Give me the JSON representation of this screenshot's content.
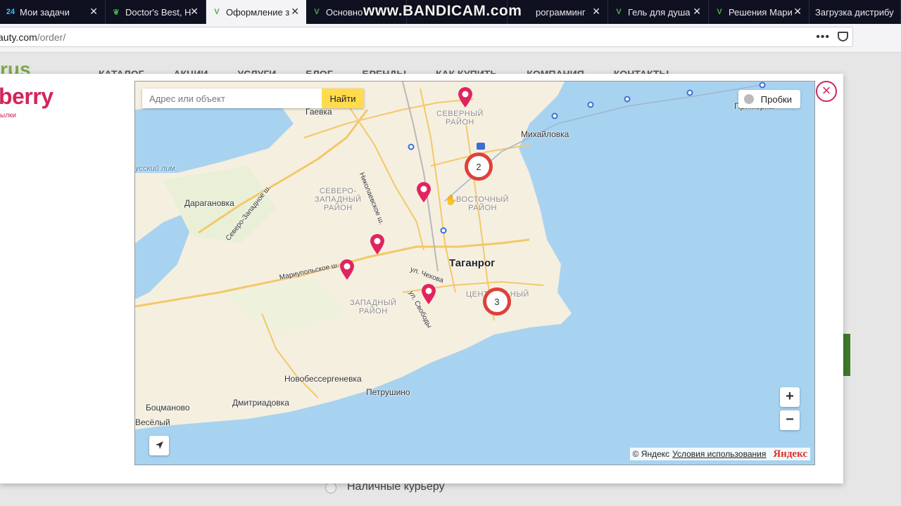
{
  "browser": {
    "tabs": [
      {
        "label": "Мои задачи",
        "icon": "bitrix24-icon",
        "icon_text": "24",
        "icon_color": "#2fc6f6",
        "active": false
      },
      {
        "label": "Doctor's Best, H",
        "icon": "leaf-icon",
        "icon_color": "#4caf50",
        "active": false
      },
      {
        "label": "Оформление з",
        "icon": "check-v-icon",
        "icon_color": "#4caf50",
        "active": true
      },
      {
        "label": "Основно",
        "icon": "check-v-icon",
        "icon_color": "#4caf50",
        "active": false
      },
      {
        "label": "рограмминг",
        "icon": "check-v-icon",
        "icon_color": "#4caf50",
        "active": false
      },
      {
        "label": "Гель для душа",
        "icon": "check-v-icon",
        "icon_color": "#4caf50",
        "active": false
      },
      {
        "label": "Решения Мари",
        "icon": "check-v-icon",
        "icon_color": "#4caf50",
        "active": false
      },
      {
        "label": "Загрузка дистрибу",
        "icon": "",
        "icon_color": "",
        "active": false
      }
    ],
    "watermark": "www.BANDICAM.com",
    "url_host": "auty.com",
    "url_path": "/order/",
    "page_actions_icon": "•••"
  },
  "page": {
    "logo_text": "rus",
    "nav": [
      "КАТАЛОГ",
      "АКЦИИ",
      "УСЛУГИ",
      "БЛОГ",
      "БРЕНДЫ",
      "КАК КУПИТЬ",
      "КОМПАНИЯ",
      "КОНТАКТЫ"
    ],
    "payment_option": "Наличные курьеру"
  },
  "modal": {
    "brand": "berry",
    "brand_sub": "ылки",
    "close_icon": "×",
    "map": {
      "search_placeholder": "Адрес или объект",
      "find_button": "Найти",
      "traffic_label": "Пробки",
      "zoom_in": "+",
      "zoom_out": "−",
      "attribution": "© Яндекс",
      "terms": "Условия использования",
      "yandex_logo": "Яндекс",
      "labels": {
        "gaevka": "Гаевка",
        "severny": "СЕВЕРНЫЙ\nРАЙОН",
        "mikhailovka": "Михайловка",
        "primorka": "Приморка",
        "russkiy": "усский лим.",
        "daraganovka": "Дарагановка",
        "severo_zapadny": "СЕВЕРО-\nЗАПАДНЫЙ\nРАЙОН",
        "vostochny": "ВОСТОЧНЫЙ\nРАЙОН",
        "taganrog": "Таганрог",
        "zapadny": "ЗАПАДНЫЙ\nРАЙОН",
        "centralny": "ЦЕНТРАЛЬНЫЙ\nРАЙОН",
        "novobessergenevka": "Новобессергеневка",
        "petrushino": "Петрушино",
        "dmitriadovka": "Дмитриадовка",
        "bocmanovo": "Боцманово",
        "vesely": "Весёлый",
        "nikolaevskoe": "Николаевское ш.",
        "severo_zapadnoe": "Северо-Западное ш.",
        "mariupolskoe": "Мариупольское ш.",
        "chekhova": "ул. Чехова",
        "svobody": "ул. Свободы"
      },
      "clusters": [
        "2",
        "3"
      ],
      "pin_color": "#e0245e",
      "cluster_color": "#e0403a"
    }
  }
}
